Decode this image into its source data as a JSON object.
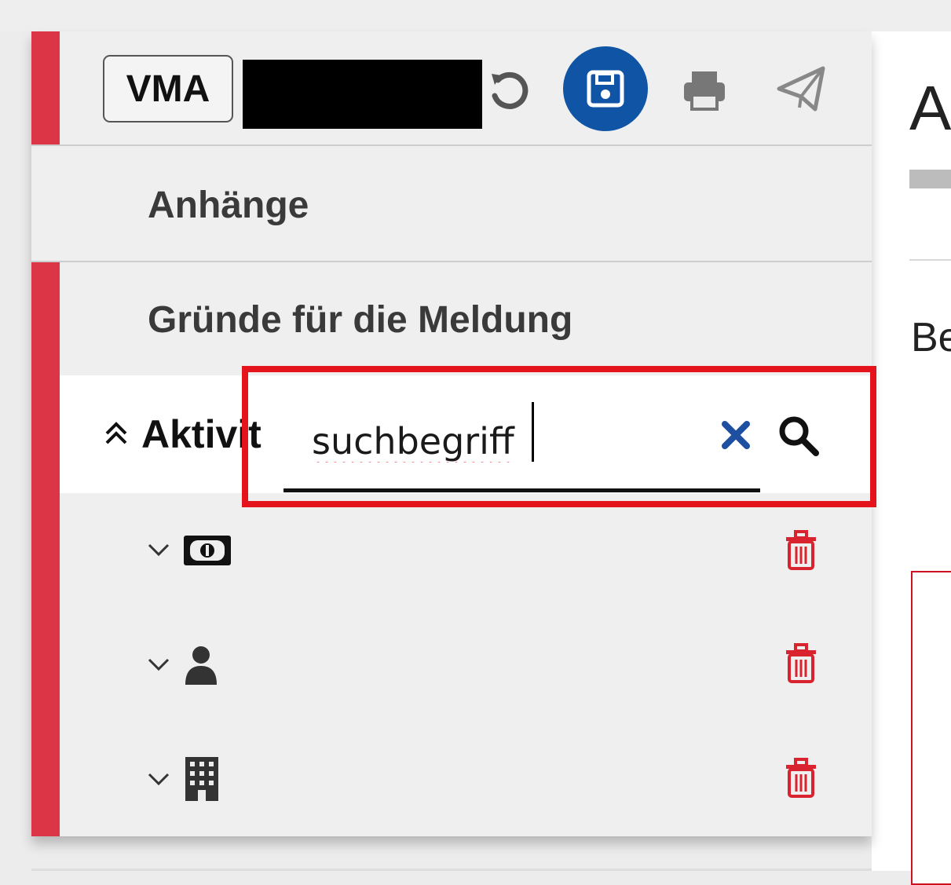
{
  "toolbar": {
    "badge_label": "VMA",
    "undo_icon": "undo-icon",
    "save_icon": "save-floppy-icon",
    "print_icon": "print-icon",
    "send_icon": "paper-plane-icon",
    "save_color": "#1055a5"
  },
  "sections": {
    "anhaenge": "Anhänge",
    "gruende": "Gründe für die Meldung",
    "aktivitaeten": "Aktivit"
  },
  "search": {
    "value": "suchbegriff"
  },
  "activities": [
    {
      "icon": "money-bill-icon"
    },
    {
      "icon": "user-icon"
    },
    {
      "icon": "building-icon"
    }
  ],
  "right_panel": {
    "heading": "A",
    "label": "Be"
  },
  "colors": {
    "accent_red": "#dc3545",
    "highlight_red": "#e5141c",
    "trash_red": "#d9232e"
  }
}
